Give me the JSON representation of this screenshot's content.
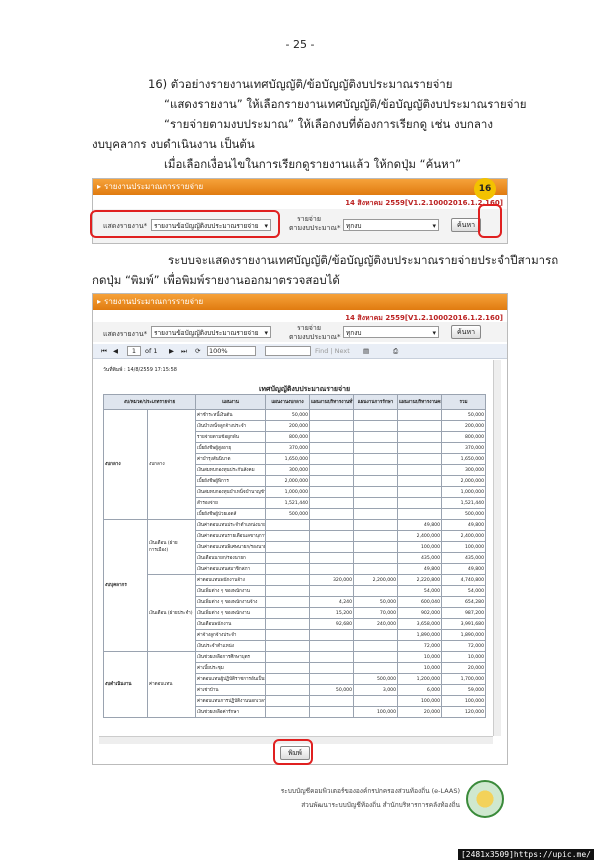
{
  "page_number": "- 25 -",
  "step": {
    "number": "16)",
    "title": "ตัวอย่างรายงานเทศบัญญัติ/ข้อบัญญัติงบประมาณรายจ่าย",
    "line2": "“แสดงรายงาน” ให้เลือกรายงานเทศบัญญัติ/ข้อบัญญัติงบประมาณรายจ่าย",
    "line3": "“รายจ่ายตามงบประมาณ” ให้เลือกงบที่ต้องการเรียกดู เช่น งบกลาง",
    "line4": "งบบุคลากร งบดำเนินงาน เป็นต้น",
    "line5": "เมื่อเลือกเงื่อนไขในการเรียกดูรายงานแล้ว ให้กดปุ่ม “ค้นหา”"
  },
  "para2": {
    "line1": "ระบบจะแสดงรายงานเทศบัญญัติ/ข้อบัญญัติงบประมาณรายจ่ายประจำปีสามารถ",
    "line2": "กดปุ่ม “พิมพ์” เพื่อพิมพ์รายงานออกมาตรวจสอบได้"
  },
  "screen1": {
    "header": "รายงานประมาณการรายจ่าย",
    "version": "14 สิงหาคม 2559[V1.2.10002016.1.2.160]",
    "report_label": "แสดงรายงาน*",
    "report_value": "รายงานข้อบัญญัติงบประมาณรายจ่าย",
    "budget_label1": "รายจ่าย",
    "budget_label2": "ตามงบประมาณ*",
    "budget_value": "ทุกงบ",
    "search_btn": "ค้นหา",
    "badge": "16"
  },
  "screen2": {
    "header": "รายงานประมาณการรายจ่าย",
    "version": "14 สิงหาคม 2559[V1.2.10002016.1.2.160]",
    "report_label": "แสดงรายงาน*",
    "report_value": "รายงานข้อบัญญัติงบประมาณรายจ่าย",
    "budget_label1": "รายจ่าย",
    "budget_label2": "ตามงบประมาณ*",
    "budget_value": "ทุกงบ",
    "search_btn": "ค้นหา",
    "toolbar": {
      "page_input": "1",
      "page_of": "of 1",
      "zoom": "100%",
      "find": "Find | Next"
    },
    "print_date": "วันที่พิมพ์ : 14/8/2559 17:15:58",
    "report_title": "เทศบัญญัติงบประมาณรายจ่าย",
    "columns": [
      "งบ/หมวด/ประเภทรายจ่าย",
      "",
      "",
      "แผนงานงบกลาง",
      "แผนงานบริหารงานทั่วไป",
      "แผนงานการรักษา",
      "แผนงานบริหารงานคลัง",
      "รวม"
    ],
    "groups": [
      {
        "name": "งบกลาง",
        "sub": "งบกลาง"
      },
      {
        "name": "งบบุคลากร",
        "sub1": "เงินเดือน (ฝ่ายการเมือง)",
        "sub2": "เงินเดือน (ฝ่ายประจำ)"
      },
      {
        "name": "งบดำเนินงาน",
        "sub": "ค่าตอบแทน"
      }
    ],
    "rows": [
      [
        "ค่าชำระหนี้เงินต้น",
        "50,000",
        "",
        "",
        "",
        "50,000"
      ],
      [
        "เงินบำเหน็จลูกจ้างประจำ",
        "200,000",
        "",
        "",
        "",
        "200,000"
      ],
      [
        "รายจ่ายตามข้อผูกพัน",
        "800,000",
        "",
        "",
        "",
        "800,000"
      ],
      [
        "เบี้ยยังชีพผู้สูงอายุ",
        "370,000",
        "",
        "",
        "",
        "370,000"
      ],
      [
        "ค่าบำรุงสันนิบาต",
        "1,650,000",
        "",
        "",
        "",
        "1,650,000"
      ],
      [
        "เงินสมทบกองทุนประกันสังคม",
        "300,000",
        "",
        "",
        "",
        "300,000"
      ],
      [
        "เบี้ยยังชีพผู้พิการ",
        "2,000,000",
        "",
        "",
        "",
        "2,000,000"
      ],
      [
        "เงินสมทบกองทุนบำเหน็จบำนาญข้าราชการส่วนท้องถิ่น (กบท.)",
        "1,000,000",
        "",
        "",
        "",
        "1,000,000"
      ],
      [
        "สำรองจ่าย",
        "1,521,440",
        "",
        "",
        "",
        "1,521,440"
      ],
      [
        "เบี้ยยังชีพผู้ป่วยเอดส์",
        "500,000",
        "",
        "",
        "",
        "500,000"
      ],
      [
        "เงินค่าตอบแทนประจำตำแหน่งนายก/รองนายก",
        "",
        "",
        "",
        "49,800",
        "49,800"
      ],
      [
        "เงินค่าตอบแทนรายเดือนเลขานุการ/ที่ปรึกษา",
        "",
        "",
        "",
        "2,400,000",
        "2,400,000"
      ],
      [
        "เงินค่าตอบแทนพิเศษนายก/รองนายก",
        "",
        "",
        "",
        "100,000",
        "100,000"
      ],
      [
        "เงินเดือนนายก/รองนายก",
        "",
        "",
        "",
        "435,000",
        "435,000"
      ],
      [
        "เงินค่าตอบแทนสมาชิกสภา",
        "",
        "",
        "",
        "49,800",
        "49,800"
      ],
      [
        "ค่าตอบแทนพนักงานจ้าง",
        "",
        "320,000",
        "2,200,000",
        "2,220,800",
        "4,740,800"
      ],
      [
        "เงินเพิ่มต่าง ๆ ของพนักงาน",
        "",
        "",
        "",
        "54,000",
        "54,000"
      ],
      [
        "เงินเพิ่มต่าง ๆ ของพนักงานจ้าง",
        "",
        "4,240",
        "50,000",
        "600,040",
        "654,280"
      ],
      [
        "เงินเพิ่มต่าง ๆ ของพนักงาน",
        "",
        "15,200",
        "70,000",
        "902,000",
        "987,200"
      ],
      [
        "เงินเดือนพนักงาน",
        "",
        "92,680",
        "240,000",
        "3,658,000",
        "3,991,680"
      ],
      [
        "ค่าจ้างลูกจ้างประจำ",
        "",
        "",
        "",
        "1,890,000",
        "1,890,000"
      ],
      [
        "เงินประจำตำแหน่ง",
        "",
        "",
        "",
        "72,000",
        "72,000"
      ],
      [
        "เงินช่วยเหลือการศึกษาบุตร",
        "",
        "",
        "",
        "10,000",
        "10,000"
      ],
      [
        "ค่าเบี้ยประชุม",
        "",
        "",
        "",
        "10,000",
        "20,000"
      ],
      [
        "ค่าตอบแทนผู้ปฏิบัติราชการอันเป็นประโยชน์",
        "",
        "",
        "500,000",
        "1,200,000",
        "1,700,000"
      ],
      [
        "ค่าเช่าบ้าน",
        "",
        "50,000",
        "3,000",
        "6,000",
        "59,000"
      ],
      [
        "ค่าตอบแทนการปฏิบัติงานนอกเวลาราชการ",
        "",
        "",
        "",
        "100,000",
        "100,000"
      ],
      [
        "เงินช่วยเหลือค่ารักษา",
        "",
        "",
        "100,000",
        "20,000",
        "120,000"
      ]
    ],
    "print_btn": "พิมพ์"
  },
  "footer": {
    "line1": "ระบบบัญชีคอมพิวเตอร์ขององค์กรปกครองส่วนท้องถิ่น (e-LAAS)",
    "line2": "ส่วนพัฒนาระบบบัญชีท้องถิ่น  สำนักบริหารการคลังท้องถิ่น"
  },
  "stamp": "[2481x3509]https://upic.me/"
}
